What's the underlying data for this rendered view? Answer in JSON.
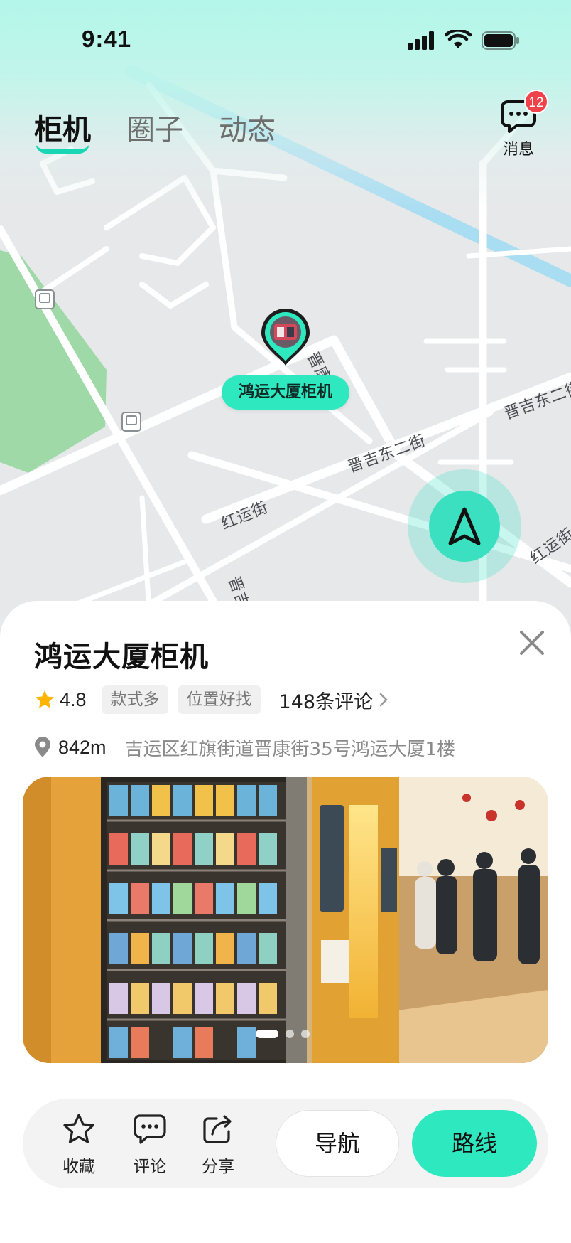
{
  "status_bar": {
    "time": "9:41"
  },
  "tabs": [
    {
      "label": "柜机",
      "active": true
    },
    {
      "label": "圈子",
      "active": false
    },
    {
      "label": "动态",
      "active": false
    }
  ],
  "messages": {
    "label": "消息",
    "badge": "12"
  },
  "map": {
    "streets": [
      "晋康街",
      "晋吉东二街",
      "晋吉东二街",
      "红运街",
      "红运街",
      "晋吉北"
    ],
    "marker_label": "鸿运大厦柜机"
  },
  "place": {
    "title": "鸿运大厦柜机",
    "rating": "4.8",
    "tags": [
      "款式多",
      "位置好找"
    ],
    "reviews": "148条评论",
    "distance": "842m",
    "address": "吉运区红旗街道晋康街35号鸿运大厦1楼"
  },
  "carousel": {
    "count": 3,
    "active": 0
  },
  "actions": {
    "favorite": "收藏",
    "comment": "评论",
    "share": "分享",
    "navigate": "导航",
    "route": "路线"
  },
  "colors": {
    "accent": "#2EE8C0",
    "badge": "#F0424A",
    "park": "#9FD9A8",
    "river": "#A9DDF2",
    "star": "#FFB400"
  }
}
